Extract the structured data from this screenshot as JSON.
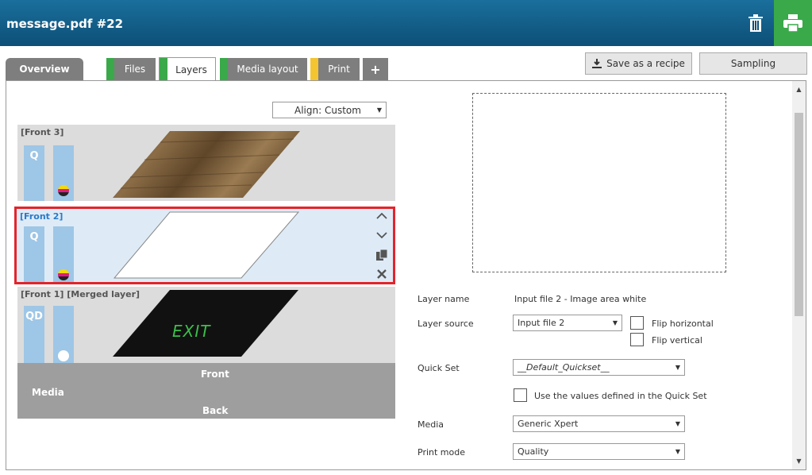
{
  "header": {
    "title": "message.pdf #22",
    "trash_icon": "trash-icon",
    "print_icon": "printer-icon"
  },
  "tabs": [
    {
      "label": "Overview"
    },
    {
      "label": "Files",
      "stripe": "#3aa94a"
    },
    {
      "label": "Layers",
      "stripe": "#3aa94a"
    },
    {
      "label": "Media layout",
      "stripe": "#3aa94a"
    },
    {
      "label": "Print",
      "stripe": "#f5c431"
    },
    {
      "label": "+"
    }
  ],
  "toolbar": {
    "save_recipe": "Save as a recipe",
    "sampling": "Sampling"
  },
  "align": {
    "value": "Align: Custom"
  },
  "layers": [
    {
      "name": "[Front 3]",
      "q": "Q"
    },
    {
      "name": "[Front 2]",
      "q": "Q"
    },
    {
      "name": "[Front 1] [Merged layer]",
      "q": "QD",
      "exit_text": "EXIT"
    }
  ],
  "mediabar": {
    "front": "Front",
    "media": "Media",
    "back": "Back"
  },
  "form": {
    "layer_name_label": "Layer name",
    "layer_name_value": "Input file 2 - Image area white",
    "layer_source_label": "Layer source",
    "layer_source_value": "Input file 2",
    "flip_horizontal": "Flip horizontal",
    "flip_vertical": "Flip vertical",
    "quick_set_label": "Quick Set",
    "quick_set_value": "__Default_Quickset__",
    "use_values": "Use the values defined in the Quick Set",
    "media_label": "Media",
    "media_value": "Generic Xpert",
    "print_mode_label": "Print mode",
    "print_mode_value": "Quality"
  },
  "colors": {
    "header": "#0d4f77",
    "print_btn": "#3aa94a",
    "selected_border": "#e3242b",
    "selected_label": "#2a7ac9",
    "q_bar": "#9ec6e6"
  }
}
